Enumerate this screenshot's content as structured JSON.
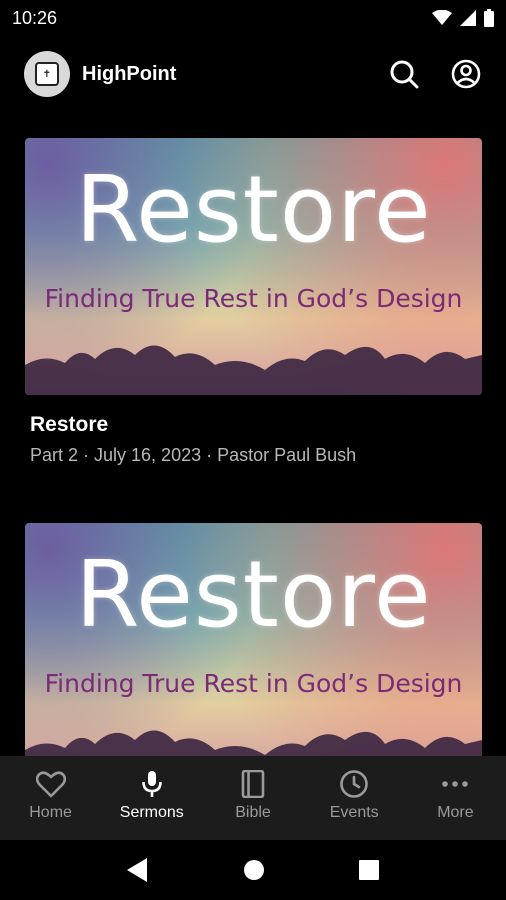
{
  "status_bar": {
    "time": "10:26"
  },
  "app_bar": {
    "title": "HighPoint"
  },
  "sermons": [
    {
      "art_title": "Restore",
      "art_subtitle": "Finding True Rest in God’s Design",
      "title": "Restore",
      "meta": "Part 2 · July 16, 2023 · Pastor Paul Bush"
    },
    {
      "art_title": "Restore",
      "art_subtitle": "Finding True Rest in God’s Design",
      "title": "",
      "meta": ""
    }
  ],
  "bottom_nav": {
    "active": "Sermons",
    "items": [
      {
        "label": "Home",
        "icon": "heart-icon"
      },
      {
        "label": "Sermons",
        "icon": "microphone-icon"
      },
      {
        "label": "Bible",
        "icon": "book-icon"
      },
      {
        "label": "Events",
        "icon": "clock-icon"
      },
      {
        "label": "More",
        "icon": "more-dots-icon"
      }
    ]
  },
  "colors": {
    "background": "#000000",
    "nav_background": "#1c1c1c",
    "inactive": "#9a9a9a",
    "meta_text": "#b8b8b8",
    "art_subtitle": "#7b2a78"
  }
}
